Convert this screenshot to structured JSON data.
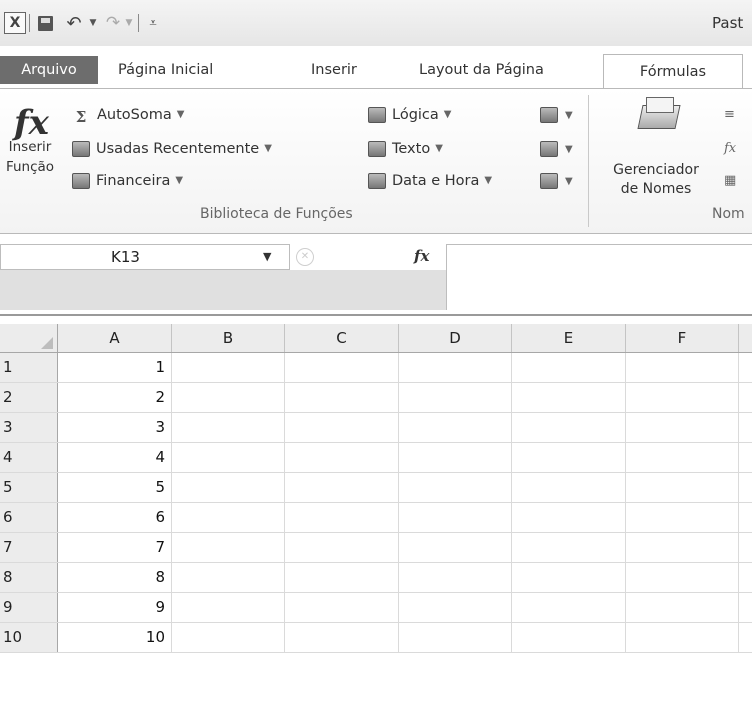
{
  "titlebar": {
    "window_title": "Past"
  },
  "tabs": [
    "Arquivo",
    "Página Inicial",
    "Inserir",
    "Layout da Página",
    "Fórmulas"
  ],
  "active_tab": "Fórmulas",
  "ribbon": {
    "insert_function": {
      "line1": "Inserir",
      "line2": "Função"
    },
    "library_items": [
      "AutoSoma",
      "Usadas Recentemente",
      "Financeira",
      "Lógica",
      "Texto",
      "Data e Hora"
    ],
    "group_library_label": "Biblioteca de Funções",
    "name_manager": {
      "line1": "Gerenciador",
      "line2": "de Nomes"
    },
    "group_names_label": "Nom"
  },
  "formula_bar": {
    "name_box": "K13",
    "formula": ""
  },
  "sheet": {
    "columns": [
      "A",
      "B",
      "C",
      "D",
      "E",
      "F"
    ],
    "rows": [
      {
        "n": "1",
        "a": "1"
      },
      {
        "n": "2",
        "a": "2"
      },
      {
        "n": "3",
        "a": "3"
      },
      {
        "n": "4",
        "a": "4"
      },
      {
        "n": "5",
        "a": "5"
      },
      {
        "n": "6",
        "a": "6"
      },
      {
        "n": "7",
        "a": "7"
      },
      {
        "n": "8",
        "a": "8"
      },
      {
        "n": "9",
        "a": "9"
      },
      {
        "n": "10",
        "a": "10"
      }
    ]
  },
  "colors": {
    "file_tab": "#6d6d6d",
    "header_bg": "#ececec",
    "gridline": "#dadada"
  }
}
